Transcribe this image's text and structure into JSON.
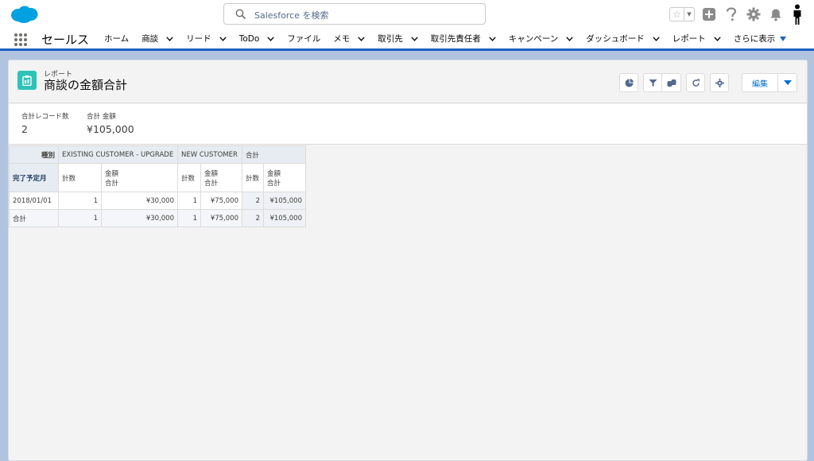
{
  "header": {
    "search_placeholder": "Salesforce を検索"
  },
  "nav": {
    "app_name": "セールス",
    "items": [
      {
        "label": "ホーム",
        "has_menu": false
      },
      {
        "label": "商談",
        "has_menu": true
      },
      {
        "label": "リード",
        "has_menu": true
      },
      {
        "label": "ToDo",
        "has_menu": true
      },
      {
        "label": "ファイル",
        "has_menu": false
      },
      {
        "label": "メモ",
        "has_menu": true
      },
      {
        "label": "取引先",
        "has_menu": true
      },
      {
        "label": "取引先責任者",
        "has_menu": true
      },
      {
        "label": "キャンペーン",
        "has_menu": true
      },
      {
        "label": "ダッシュボード",
        "has_menu": true
      },
      {
        "label": "レポート",
        "has_menu": true
      }
    ],
    "more_label": "さらに表示"
  },
  "report": {
    "eyebrow": "レポート",
    "title": "商談の金額合計",
    "edit_label": "編集",
    "summary": [
      {
        "label": "合計レコード数",
        "value": "2"
      },
      {
        "label": "合計 金額",
        "value": "¥105,000"
      }
    ],
    "table": {
      "col_group_label": "種別",
      "row_group_label": "完了予定月",
      "groups": [
        "EXISTING CUSTOMER - UPGRADE",
        "NEW CUSTOMER",
        "合計"
      ],
      "count_label": "計数",
      "amount_label_1": "金額",
      "amount_label_2": "合計",
      "rows": [
        {
          "label": "2018/01/01",
          "c1": "1",
          "a1": "¥30,000",
          "c2": "1",
          "a2": "¥75,000",
          "c3": "2",
          "a3": "¥105,000"
        },
        {
          "label": "合計",
          "c1": "1",
          "a1": "¥30,000",
          "c2": "1",
          "a2": "¥75,000",
          "c3": "2",
          "a3": "¥105,000"
        }
      ]
    }
  },
  "colors": {
    "brand_blue": "#1d5fbf",
    "link_blue": "#0070d2",
    "report_icon": "#2ec2b8",
    "background": "#b0c4df"
  }
}
